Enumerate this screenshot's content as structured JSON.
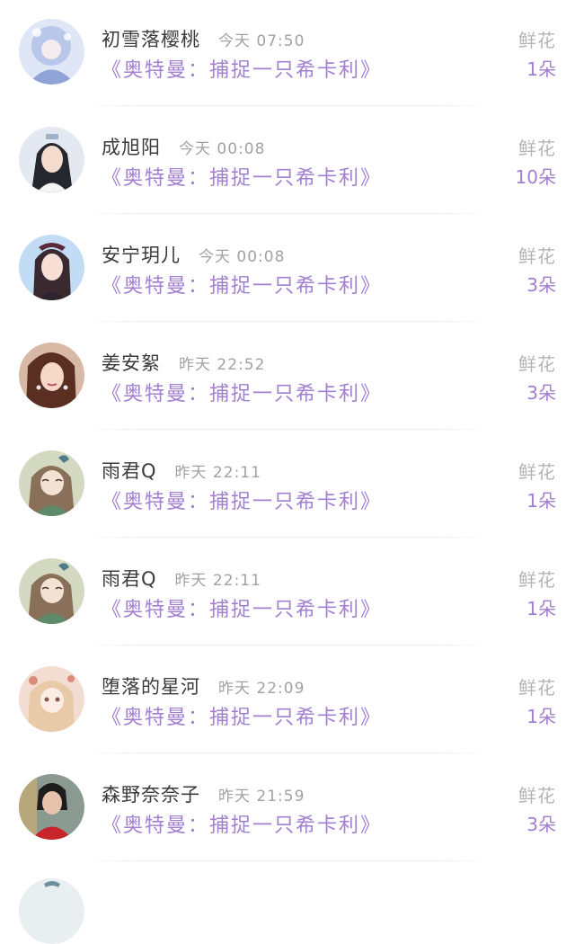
{
  "rows": [
    {
      "name": "初雪落樱桃",
      "time": "今天 07:50",
      "work": "《奥特曼：捕捉一只希卡利》",
      "gift": "鲜花",
      "count": "1朵",
      "avatar_color": "#b9c8ea",
      "avatar_accent": "#7e93c8"
    },
    {
      "name": "成旭阳",
      "time": "今天 00:08",
      "work": "《奥特曼：捕捉一只希卡利》",
      "gift": "鲜花",
      "count": "10朵",
      "avatar_color": "#d9e2ef",
      "avatar_accent": "#2b2b33"
    },
    {
      "name": "安宁玥儿",
      "time": "今天 00:08",
      "work": "《奥特曼：捕捉一只希卡利》",
      "gift": "鲜花",
      "count": "3朵",
      "avatar_color": "#b6d2f2",
      "avatar_accent": "#3a2a30"
    },
    {
      "name": "姜安絮",
      "time": "昨天 22:52",
      "work": "《奥特曼：捕捉一只希卡利》",
      "gift": "鲜花",
      "count": "3朵",
      "avatar_color": "#caa58e",
      "avatar_accent": "#5a2f22"
    },
    {
      "name": "雨君Q",
      "time": "昨天 22:11",
      "work": "《奥特曼：捕捉一只希卡利》",
      "gift": "鲜花",
      "count": "1朵",
      "avatar_color": "#c7d0b2",
      "avatar_accent": "#6e5a45"
    },
    {
      "name": "雨君Q",
      "time": "昨天 22:11",
      "work": "《奥特曼：捕捉一只希卡利》",
      "gift": "鲜花",
      "count": "1朵",
      "avatar_color": "#c7d0b2",
      "avatar_accent": "#6e5a45"
    },
    {
      "name": "堕落的星河",
      "time": "昨天 22:09",
      "work": "《奥特曼：捕捉一只希卡利》",
      "gift": "鲜花",
      "count": "1朵",
      "avatar_color": "#f2d6c8",
      "avatar_accent": "#c98f6d"
    },
    {
      "name": "森野奈奈子",
      "time": "昨天 21:59",
      "work": "《奥特曼：捕捉一只希卡利》",
      "gift": "鲜花",
      "count": "3朵",
      "avatar_color": "#9fb0a8",
      "avatar_accent": "#c8242c"
    }
  ],
  "colors": {
    "accent": "#a27fd0",
    "name": "#3a3a3a",
    "muted": "#a2a2a2"
  }
}
